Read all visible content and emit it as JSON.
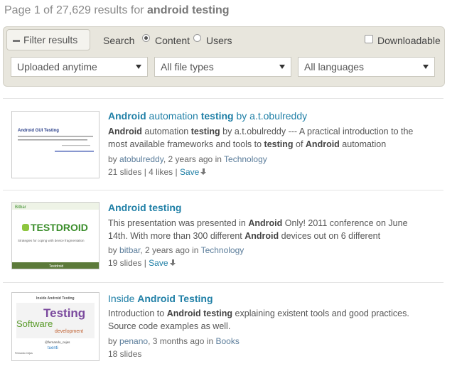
{
  "header": {
    "prefix": "Page 1 of 27,629 results for ",
    "query": "android testing"
  },
  "filter": {
    "toggle_label": "Filter results",
    "search_label": "Search",
    "options": [
      "Content",
      "Users"
    ],
    "selected": "Content",
    "downloadable_label": "Downloadable",
    "downloadable_checked": false,
    "selects": {
      "uploaded": "Uploaded anytime",
      "filetype": "All file types",
      "language": "All languages"
    }
  },
  "results": [
    {
      "title_parts": [
        {
          "t": "Android",
          "kw": true
        },
        {
          "t": " automation ",
          "kw": false
        },
        {
          "t": "testing",
          "kw": true
        },
        {
          "t": " by a.t.obulreddy",
          "kw": false
        }
      ],
      "desc_parts": [
        {
          "t": "Android",
          "kw": true
        },
        {
          "t": " automation ",
          "kw": false
        },
        {
          "t": "testing",
          "kw": true
        },
        {
          "t": " by a.t.obulreddy --- A practical introduction to the most available frameworks and tools to ",
          "kw": false
        },
        {
          "t": "testing",
          "kw": true
        },
        {
          "t": " of ",
          "kw": false
        },
        {
          "t": "Android",
          "kw": true
        },
        {
          "t": " automation",
          "kw": false
        }
      ],
      "author": "atobulreddy",
      "age": "2 years ago",
      "category": "Technology",
      "stats": "21 slides | 4 likes | ",
      "save": "Save",
      "thumb": {
        "heading": "Android GUI Testing",
        "sub": "A practical introduction to the most available frameworks and tools to testing of Android applications",
        "author": "A.T.OBULREDDY",
        "email": "www.android-testing-tools.com"
      }
    },
    {
      "title_parts": [
        {
          "t": "Android testing",
          "kw": true
        }
      ],
      "desc_parts": [
        {
          "t": "This presentation was presented in ",
          "kw": false
        },
        {
          "t": "Android",
          "kw": true
        },
        {
          "t": " Only! 2011 conference on June 14th. With more than 300 different ",
          "kw": false
        },
        {
          "t": "Android",
          "kw": true
        },
        {
          "t": " devices out on 6 different",
          "kw": false
        }
      ],
      "author": "bitbar",
      "age": "2 years ago",
      "category": "Technology",
      "stats": "19 slides | ",
      "save": "Save",
      "thumb": {
        "brand": "TESTDROID",
        "tag": "Strategies for coping with device fragmentation",
        "top": "Bitbar",
        "footer": "Testdroid"
      }
    },
    {
      "title_parts": [
        {
          "t": "Inside ",
          "kw": false
        },
        {
          "t": "Android Testing",
          "kw": true
        }
      ],
      "desc_parts": [
        {
          "t": "Introduction to ",
          "kw": false
        },
        {
          "t": "Android testing",
          "kw": true
        },
        {
          "t": " explaining existent tools and good practices. Source code examples as well.",
          "kw": false
        }
      ],
      "author": "penano",
      "age": "3 months ago",
      "category": "Books",
      "stats": "18 slides",
      "save": "",
      "thumb": {
        "heading": "Inside Android Testing",
        "w1": "Testing",
        "w2": "Software",
        "w3": "development",
        "handle": "@fernando_cejas",
        "brand": "tuenti",
        "caption": "Fernando Cejas"
      }
    }
  ],
  "colors": {
    "link": "#1f7fa6",
    "panel": "#e8e6dd",
    "testdroid_green": "#3a8d2a"
  }
}
